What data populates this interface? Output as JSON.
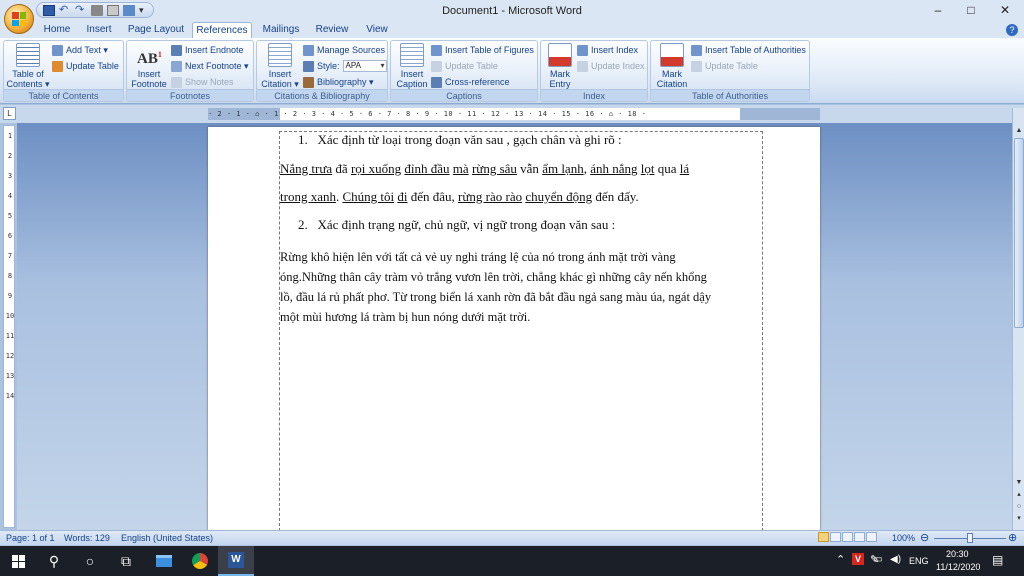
{
  "window": {
    "title": "Document1 - Microsoft Word",
    "minimize": "–",
    "maximize": "□",
    "close": "✕"
  },
  "qat": {
    "dropdown": "▾"
  },
  "tabs": [
    "Home",
    "Insert",
    "Page Layout",
    "References",
    "Mailings",
    "Review",
    "View"
  ],
  "active_tab": "References",
  "help": "?",
  "ribbon": {
    "toc": {
      "big1": "Table of",
      "big2": "Contents ▾",
      "add_text": "Add Text ▾",
      "update_table": "Update Table",
      "label": "Table of Contents"
    },
    "footnotes": {
      "big1": "Insert",
      "big2": "Footnote",
      "insert_endnote": "Insert Endnote",
      "next_footnote": "Next Footnote ▾",
      "show_notes": "Show Notes",
      "label": "Footnotes"
    },
    "citations": {
      "big1": "Insert",
      "big2": "Citation ▾",
      "manage_sources": "Manage Sources",
      "style_label": "Style:",
      "style_value": "APA",
      "bibliography": "Bibliography ▾",
      "label": "Citations & Bibliography"
    },
    "captions": {
      "big1": "Insert",
      "big2": "Caption",
      "insert_tof": "Insert Table of Figures",
      "update_table": "Update Table",
      "cross_reference": "Cross-reference",
      "label": "Captions"
    },
    "index": {
      "big1": "Mark",
      "big2": "Entry",
      "insert_index": "Insert Index",
      "update_index": "Update Index",
      "label": "Index"
    },
    "toa": {
      "big1": "Mark",
      "big2": "Citation",
      "insert_toa": "Insert Table of Authorities",
      "update_table": "Update Table",
      "label": "Table of Authorities"
    }
  },
  "ruler": {
    "button": "L",
    "horizontal": "· 2 · 1 · ⌂ · 1 · 2 · 3 · 4 · 5 · 6 · 7 · 8 · 9 · 10 · 11 · 12 · 13 · 14 · 15 · 16 · ⌂ · 18 ·",
    "vertical": "1\n2\n3\n4\n5\n6\n7\n8\n9\n10\n11\n12\n13\n14"
  },
  "document": {
    "line1_num": "1.",
    "line1": "Xác định từ loại trong đoạn văn sau , gạch chân và ghi rõ :",
    "p1": [
      {
        "t": "Nắng trưa",
        "u": true
      },
      {
        "t": " đã ",
        "u": false
      },
      {
        "t": "rọi xuống",
        "u": true
      },
      {
        "t": " ",
        "u": false
      },
      {
        "t": "đỉnh đầu",
        "u": true
      },
      {
        "t": " ",
        "u": false
      },
      {
        "t": "mà",
        "u": true
      },
      {
        "t": " ",
        "u": false
      },
      {
        "t": "rừng sâu",
        "u": true
      },
      {
        "t": " vẫn ",
        "u": false
      },
      {
        "t": "ẩm lạnh",
        "u": true
      },
      {
        "t": ", ",
        "u": false
      },
      {
        "t": "ánh nắng",
        "u": true
      },
      {
        "t": " ",
        "u": false
      },
      {
        "t": "lọt",
        "u": true
      },
      {
        "t": " qua ",
        "u": false
      },
      {
        "t": "lá",
        "u": true
      }
    ],
    "p2": [
      {
        "t": "trong xanh",
        "u": true
      },
      {
        "t": ". ",
        "u": false
      },
      {
        "t": "Chúng tôi",
        "u": true
      },
      {
        "t": " ",
        "u": false
      },
      {
        "t": "đi",
        "u": true
      },
      {
        "t": " đến đâu, ",
        "u": false
      },
      {
        "t": "rừng rào rào",
        "u": true
      },
      {
        "t": " ",
        "u": false
      },
      {
        "t": "chuyển động",
        "u": true
      },
      {
        "t": " đến đấy.",
        "u": false
      }
    ],
    "line2_num": "2.",
    "line2": "Xác định trạng ngữ, chủ ngữ, vị ngữ trong đoạn văn sau :",
    "p3": [
      "Rừng khô hiện lên với tất cả vẻ uy nghi tráng lệ của nó trong ánh mặt trời  vàng",
      "óng.Những thân cây tràm vỏ trắng vươn lên trời, chẳng khác gì những cây nến khổng",
      "lồ, đầu lá rủ phất phơ. Từ trong biển lá xanh rờn đã bắt đầu ngả sang màu úa, ngát dậy",
      "một mùi hương lá tràm bị hun nóng dưới mặt trời."
    ]
  },
  "status": {
    "page": "Page: 1 of 1",
    "words": "Words: 129",
    "language": "English (United States)",
    "zoom": "100%",
    "zoom_level": 100
  },
  "taskbar": {
    "lang": "ENG",
    "time": "20:30",
    "date": "11/12/2020"
  },
  "colors": {
    "word_blue": "#2b579a",
    "ribbon_text": "#15428b",
    "taskbar": "#1b1f27"
  }
}
